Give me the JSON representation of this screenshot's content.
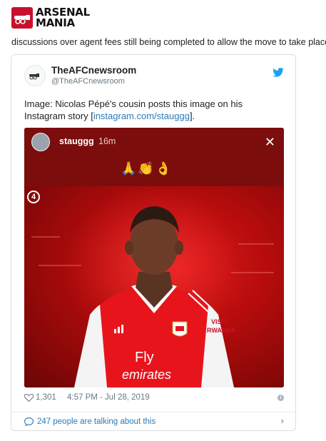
{
  "brand": {
    "line1": "ARSENAL",
    "line2": "MANIA",
    "logo_icon": "cannon-icon",
    "color": "#c8102e"
  },
  "lead_text": "discussions over agent fees still being completed to allow the move to take place.",
  "tweet": {
    "display_name": "TheAFCnewsroom",
    "handle": "@TheAFCnewsroom",
    "brand_icon": "twitter-bird-icon",
    "text_before": "Image: Nicolas Pépé's cousin posts this image on his Instagram story [",
    "link_text": "instagram.com/stauggg",
    "text_after": "].",
    "link_color": "#2b7bb9",
    "media": {
      "story_user": "stauggg",
      "story_time": "16m",
      "close_icon": "close-icon",
      "emojis": "🙏👏👌",
      "badge": "4",
      "jersey_sponsor_line1": "Fly",
      "jersey_sponsor_line2": "emirates",
      "sleeve_text_line1": "VISIT",
      "sleeve_text_line2": "RWANDA"
    },
    "likes": "1,301",
    "timestamp": "4:57 PM - Jul 28, 2019",
    "talk_text": "247 people are talking about this"
  }
}
